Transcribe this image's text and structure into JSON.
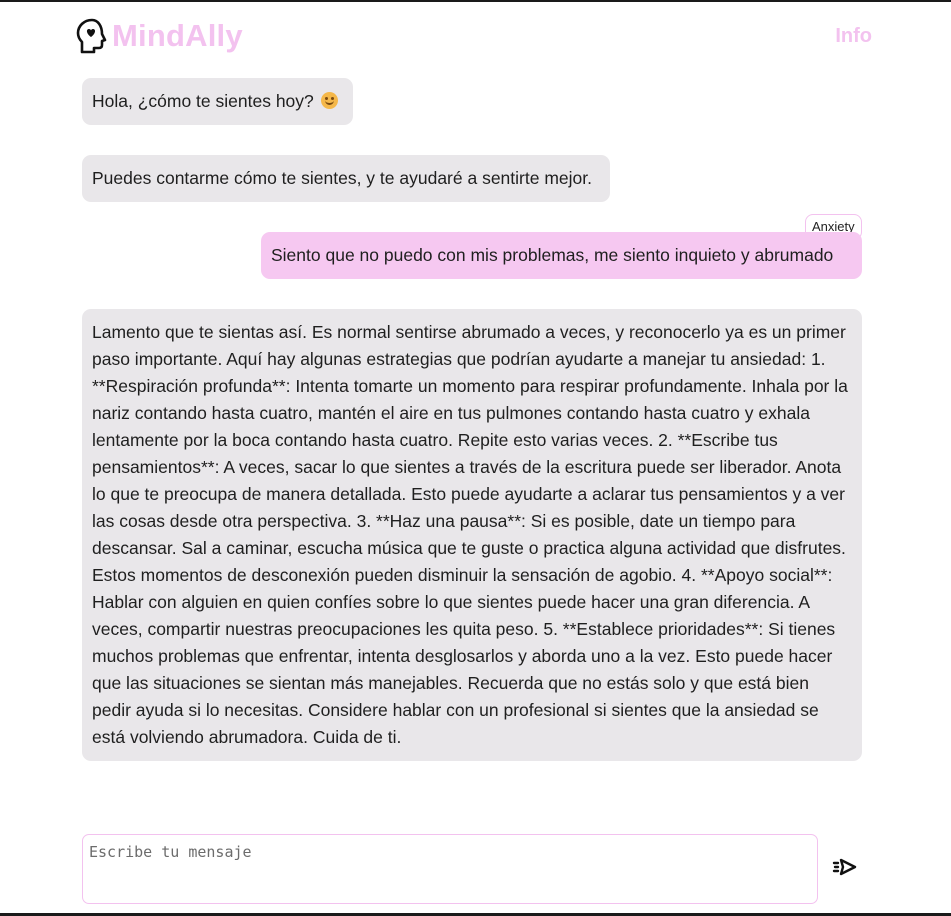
{
  "header": {
    "brand_name": "MindAlly",
    "brand_icon": "head-heart-icon",
    "info_label": "Info"
  },
  "chat": {
    "messages": [
      {
        "role": "bot",
        "text": "Hola, ¿cómo te sientes hoy?",
        "emoji": "smiling-face-icon"
      },
      {
        "role": "bot",
        "text": "Puedes contarme cómo te sientes, y te ayudaré a sentirte mejor."
      },
      {
        "role": "user",
        "text": "Siento que no puedo con mis problemas, me siento inquieto y abrumado",
        "tag": "Anxiety"
      },
      {
        "role": "bot",
        "text": "Lamento que te sientas así. Es normal sentirse abrumado a veces, y reconocerlo ya es un primer paso importante. Aquí hay algunas estrategias que podrían ayudarte a manejar tu ansiedad: 1. **Respiración profunda**: Intenta tomarte un momento para respirar profundamente. Inhala por la nariz contando hasta cuatro, mantén el aire en tus pulmones contando hasta cuatro y exhala lentamente por la boca contando hasta cuatro. Repite esto varias veces. 2. **Escribe tus pensamientos**: A veces, sacar lo que sientes a través de la escritura puede ser liberador. Anota lo que te preocupa de manera detallada. Esto puede ayudarte a aclarar tus pensamientos y a ver las cosas desde otra perspectiva. 3. **Haz una pausa**: Si es posible, date un tiempo para descansar. Sal a caminar, escucha música que te guste o practica alguna actividad que disfrutes. Estos momentos de desconexión pueden disminuir la sensación de agobio. 4. **Apoyo social**: Hablar con alguien en quien confíes sobre lo que sientes puede hacer una gran diferencia. A veces, compartir nuestras preocupaciones les quita peso. 5. **Establece prioridades**: Si tienes muchos problemas que enfrentar, intenta desglosarlos y aborda uno a la vez. Esto puede hacer que las situaciones se sientan más manejables. Recuerda que no estás solo y que está bien pedir ayuda si lo necesitas. Considere hablar con un profesional si sientes que la ansiedad se está volviendo abrumadora. Cuida de ti."
      }
    ]
  },
  "composer": {
    "placeholder": "Escribe tu mensaje",
    "value": "",
    "send_icon": "send-icon"
  },
  "colors": {
    "accent": "#f3c2ef",
    "user_bubble": "#f6c8f1",
    "bot_bubble": "#e9e7ea"
  }
}
